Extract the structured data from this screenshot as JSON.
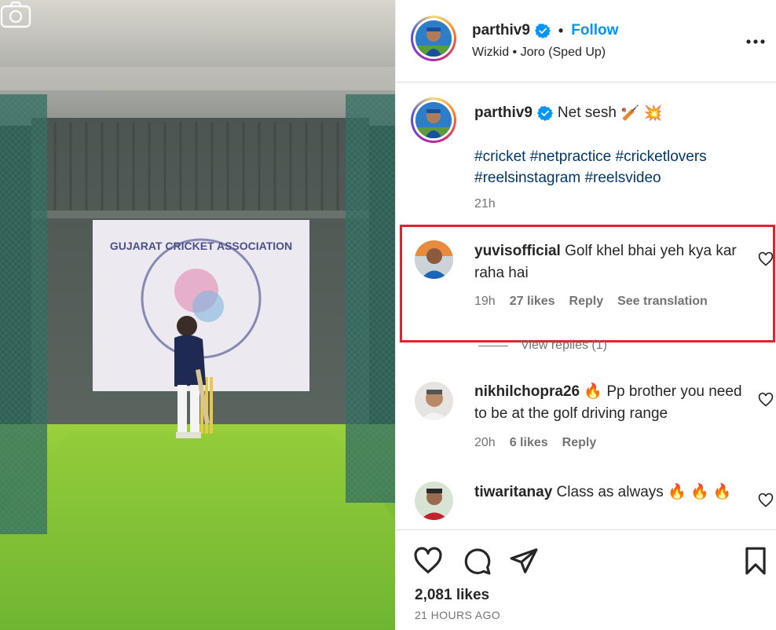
{
  "post_header": {
    "username": "parthiv9",
    "separator": "•",
    "follow_label": "Follow",
    "audio": "Wizkid • Joro (Sped Up)"
  },
  "caption": {
    "username": "parthiv9",
    "text": "Net sesh",
    "emoji": "🏏 💥",
    "hashtags": "#cricket #netpractice #cricketlovers #reelsinstagram #reelsvideo",
    "time": "21h"
  },
  "comments": [
    {
      "username": "yuvisofficial",
      "text": "Golf khel bhai yeh kya kar raha hai",
      "time": "19h",
      "likes": "27 likes",
      "reply_label": "Reply",
      "translation_label": "See translation",
      "view_replies": "View replies (1)"
    },
    {
      "username": "nikhilchopra26",
      "text": "🔥 Pp brother you need to be at the golf driving range",
      "time": "20h",
      "likes": "6 likes",
      "reply_label": "Reply"
    },
    {
      "username": "tiwaritanay",
      "text": "Class as always 🔥 🔥 🔥"
    }
  ],
  "footer": {
    "likes": "2,081 likes",
    "posted": "21 HOURS AGO"
  },
  "media": {
    "banner_text": "GUJARAT CRICKET ASSOCIATION"
  },
  "colors": {
    "accent": "#0095f6",
    "highlight_border": "#e0242e",
    "hashtag": "#00376b",
    "muted": "#737373"
  }
}
